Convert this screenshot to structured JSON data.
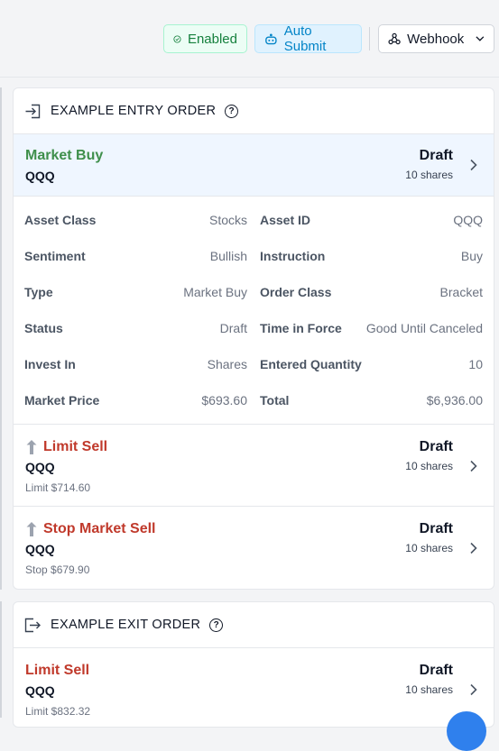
{
  "topbar": {
    "enabled_label": "Enabled",
    "auto_submit_label": "Auto Submit",
    "webhook_label": "Webhook"
  },
  "entry": {
    "section_title": "EXAMPLE ENTRY ORDER",
    "main": {
      "title": "Market Buy",
      "symbol": "QQQ",
      "status": "Draft",
      "qty": "10 shares"
    },
    "details": [
      {
        "label": "Asset Class",
        "value": "Stocks"
      },
      {
        "label": "Asset ID",
        "value": "QQQ"
      },
      {
        "label": "Sentiment",
        "value": "Bullish"
      },
      {
        "label": "Instruction",
        "value": "Buy"
      },
      {
        "label": "Type",
        "value": "Market Buy"
      },
      {
        "label": "Order Class",
        "value": "Bracket"
      },
      {
        "label": "Status",
        "value": "Draft"
      },
      {
        "label": "Time in Force",
        "value": "Good Until Canceled"
      },
      {
        "label": "Invest In",
        "value": "Shares"
      },
      {
        "label": "Entered Quantity",
        "value": "10"
      },
      {
        "label": "Market Price",
        "value": "$693.60"
      },
      {
        "label": "Total",
        "value": "$6,936.00"
      }
    ],
    "legs": [
      {
        "title": "Limit Sell",
        "symbol": "QQQ",
        "sub": "Limit $714.60",
        "status": "Draft",
        "qty": "10 shares"
      },
      {
        "title": "Stop Market Sell",
        "symbol": "QQQ",
        "sub": "Stop $679.90",
        "status": "Draft",
        "qty": "10 shares"
      }
    ]
  },
  "exit": {
    "section_title": "EXAMPLE EXIT ORDER",
    "order": {
      "title": "Limit Sell",
      "symbol": "QQQ",
      "sub": "Limit $832.32",
      "status": "Draft",
      "qty": "10 shares"
    }
  },
  "colors": {
    "buy": "#3f8f4b",
    "sell": "#c0392b",
    "enabled": "#15803d",
    "auto_submit": "#0284c7"
  }
}
